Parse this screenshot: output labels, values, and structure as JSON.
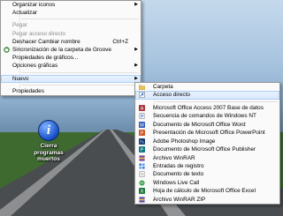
{
  "context_menu": {
    "items": [
      {
        "label": "Organizar iconos",
        "submenu": true,
        "disabled": false
      },
      {
        "label": "Actualizar",
        "disabled": false
      },
      {
        "separator": true
      },
      {
        "label": "Pegar",
        "disabled": true
      },
      {
        "label": "Pegar acceso directo",
        "disabled": true
      },
      {
        "label": "Deshacer Cambiar nombre",
        "shortcut": "Ctrl+Z",
        "disabled": false
      },
      {
        "label": "Sincronización de la carpeta de Groove",
        "submenu": true,
        "icon": "groove-sync-icon",
        "disabled": false
      },
      {
        "label": "Propiedades de gráficos...",
        "disabled": false
      },
      {
        "label": "Opciones gráficas",
        "submenu": true,
        "disabled": false
      },
      {
        "separator": true
      },
      {
        "label": "Nuevo",
        "submenu": true,
        "highlighted": true,
        "disabled": false
      },
      {
        "separator": true
      },
      {
        "label": "Propiedades",
        "disabled": false
      }
    ]
  },
  "submenu_nuevo": {
    "items": [
      {
        "label": "Carpeta",
        "icon": "folder-icon"
      },
      {
        "label": "Acceso directo",
        "icon": "shortcut-icon",
        "highlighted": true
      },
      {
        "separator": true
      },
      {
        "label": "Microsoft Office Access 2007 Base de datos",
        "icon": "access-icon"
      },
      {
        "label": "Secuencia de comandos de Windows NT",
        "icon": "script-icon"
      },
      {
        "label": "Documento de Microsoft Office Word",
        "icon": "word-icon"
      },
      {
        "label": "Presentación de Microsoft Office PowerPoint",
        "icon": "powerpoint-icon"
      },
      {
        "label": "Adobe Photoshop Image",
        "icon": "photoshop-icon"
      },
      {
        "label": "Documento de Microsoft Office Publisher",
        "icon": "publisher-icon"
      },
      {
        "label": "Archivo WinRAR",
        "icon": "winrar-icon"
      },
      {
        "label": "Entradas de registro",
        "icon": "registry-icon"
      },
      {
        "label": "Documento de texto",
        "icon": "text-document-icon"
      },
      {
        "label": "Windows Live Call",
        "icon": "live-call-icon"
      },
      {
        "label": "Hoja de cálculo de Microsoft Office Excel",
        "icon": "excel-icon"
      },
      {
        "label": "Archivo WinRAR ZIP",
        "icon": "winrar-zip-icon"
      }
    ]
  },
  "desktop_icon": {
    "label_line1": "Cierra",
    "label_line2": "programas",
    "label_line3": "muertos",
    "glyph": "i"
  }
}
